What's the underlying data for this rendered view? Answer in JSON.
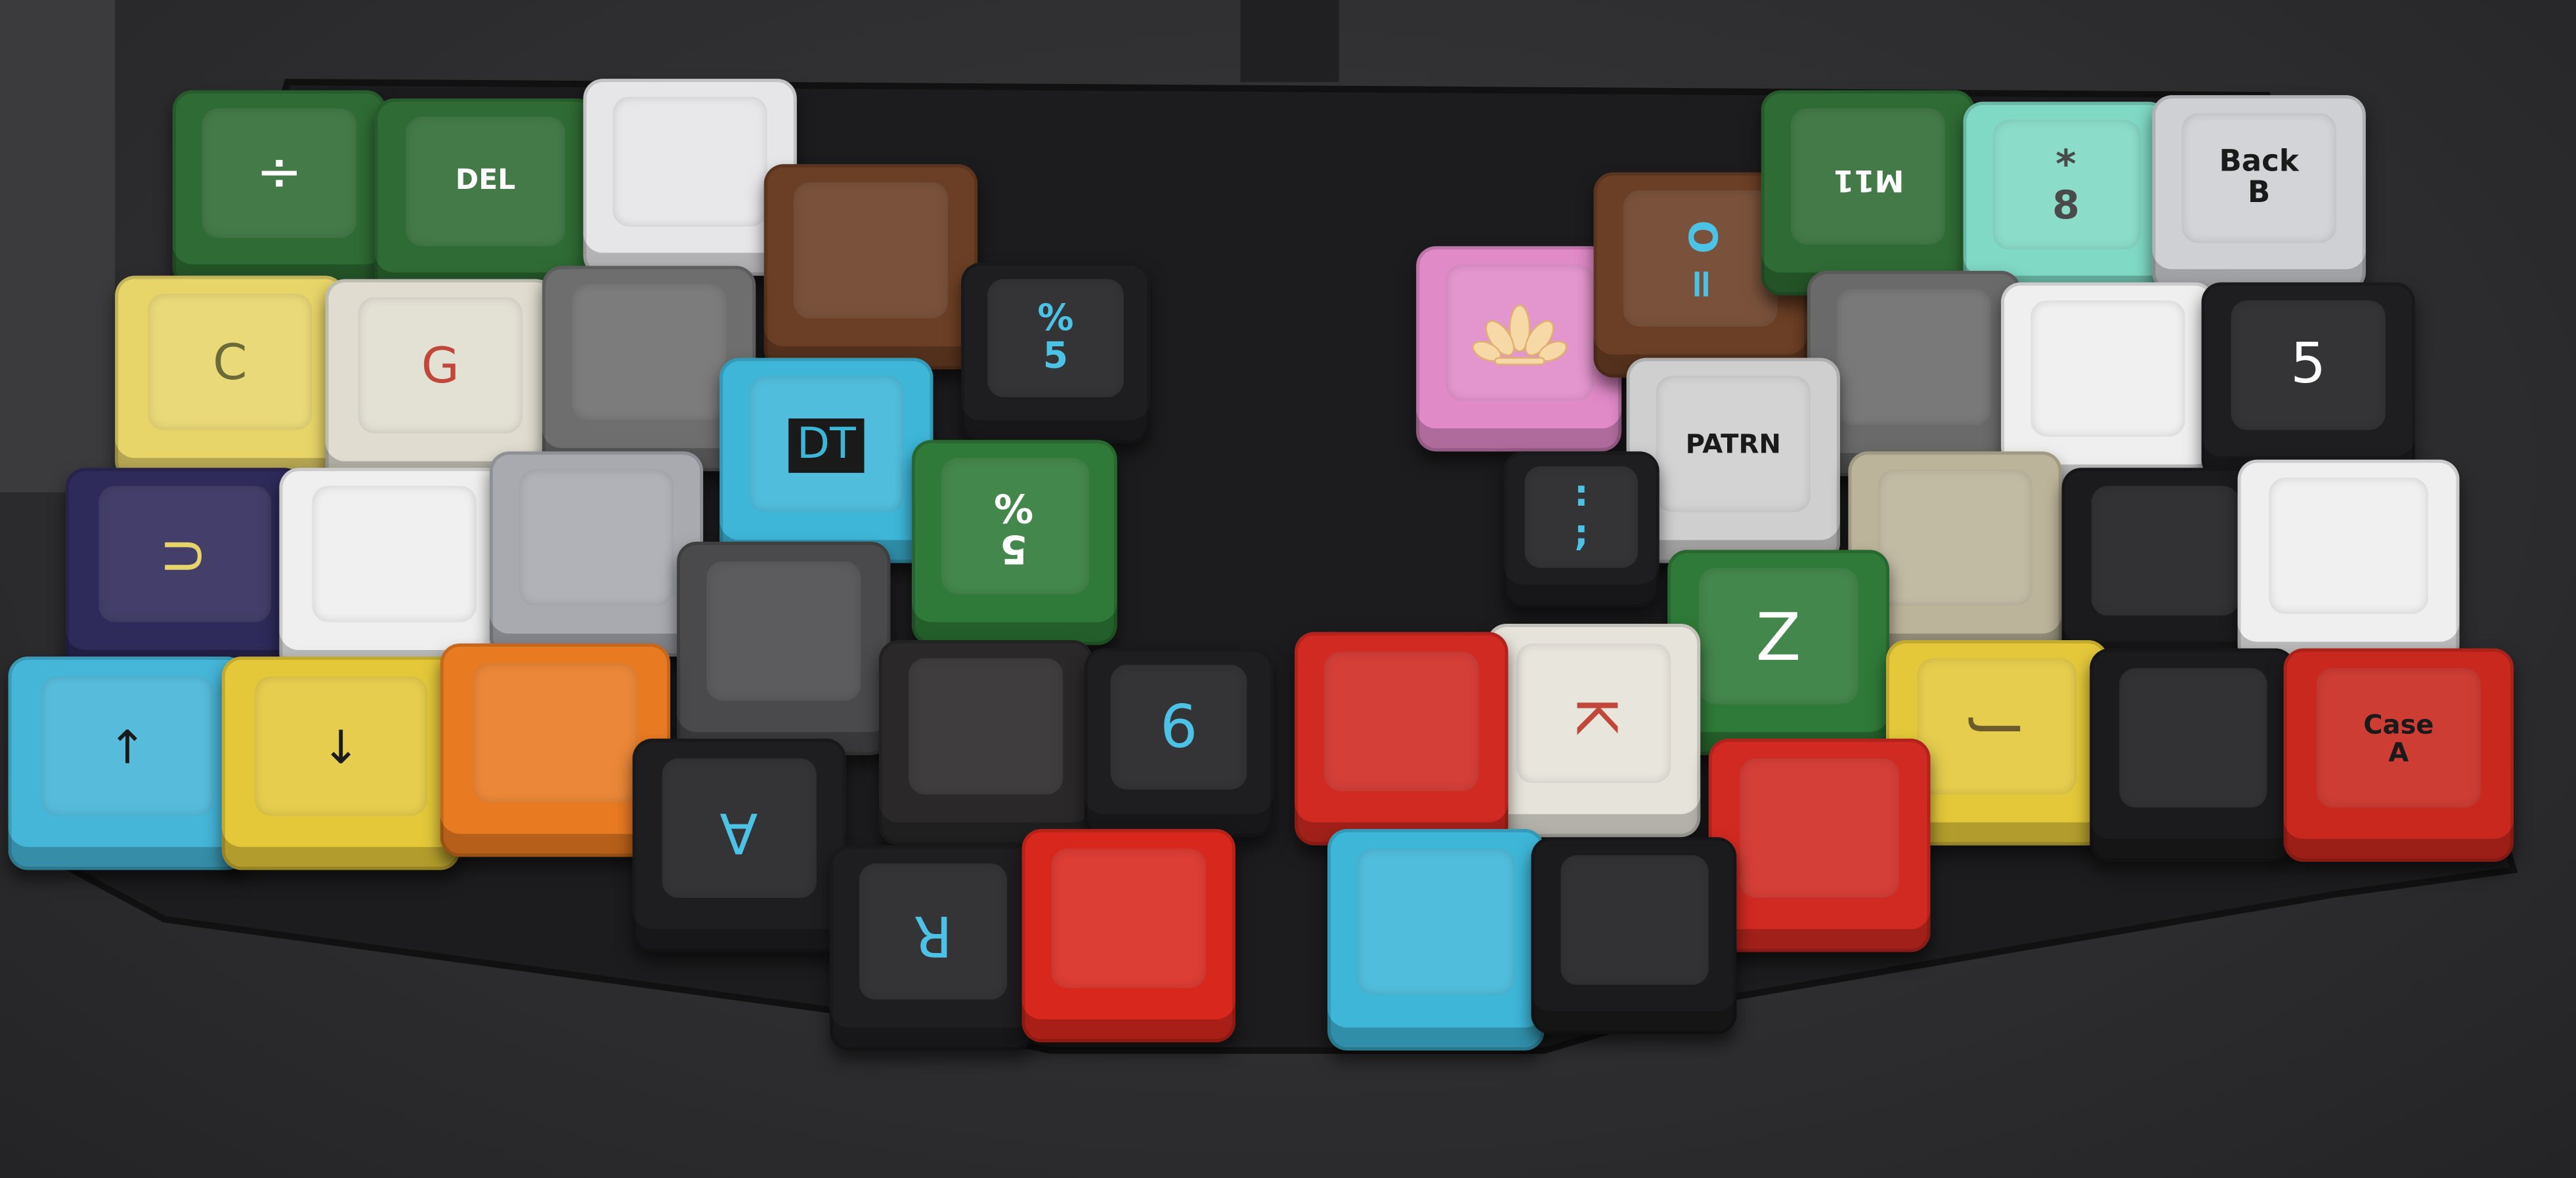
{
  "colors": {
    "background": "#2e2e30",
    "plate": "#1c1c1e",
    "green": "#2f6b34",
    "cyan_legend": "#4cc3e6"
  },
  "left_half": {
    "keys": [
      {
        "legend": "÷",
        "color": "#2f6b34",
        "legend_color": "#ffffff"
      },
      {
        "legend": "DEL",
        "color": "#2f6b34",
        "legend_color": "#ffffff"
      },
      {
        "legend": "",
        "color": "#e6e6e8"
      },
      {
        "legend": "",
        "color": "#6b3f25"
      },
      {
        "legend": "%\n5",
        "color": "#1e1e20",
        "legend_color": "#4cc3e6"
      },
      {
        "legend": "C",
        "color": "#e8d56a",
        "legend_color": "#6b6b3a"
      },
      {
        "legend": "G",
        "color": "#e0ddd0",
        "legend_color": "#c0473a"
      },
      {
        "legend": "",
        "color": "#6e6e6e"
      },
      {
        "legend": "DT",
        "color": "#3eb6d8",
        "legend_color": "#1a1a1a"
      },
      {
        "legend": "5\n%",
        "color": "#2f7a38",
        "legend_color": "#ffffff"
      },
      {
        "legend": "U",
        "color": "#2e2a5a",
        "legend_color": "#e8d56a"
      },
      {
        "legend": "",
        "color": "#efefef"
      },
      {
        "legend": "",
        "color": "#a8aab0"
      },
      {
        "legend": "",
        "color": "#4a4a4c"
      },
      {
        "legend": "↑",
        "color": "#45b5d8",
        "legend_color": "#1a1a1a"
      },
      {
        "legend": "↓",
        "color": "#e4c83a",
        "legend_color": "#1a1a1a"
      },
      {
        "legend": "",
        "color": "#e87a22"
      },
      {
        "legend": "",
        "color": "#2a2828"
      },
      {
        "legend": "6",
        "color": "#1e1e20",
        "legend_color": "#4cc3e6"
      },
      {
        "legend": "A",
        "color": "#1e1e20",
        "legend_color": "#4cc3e6"
      },
      {
        "legend": "R",
        "color": "#1e1e20",
        "legend_color": "#4cc3e6"
      },
      {
        "legend": "",
        "color": "#d8281e"
      }
    ]
  },
  "right_half": {
    "keys": [
      {
        "legend": "",
        "icon": "lotus-flower-icon",
        "color": "#e08ac8"
      },
      {
        "legend": "O =",
        "color": "#6b3f25",
        "legend_color": "#4cc3e6"
      },
      {
        "legend": "M11",
        "color": "#2f6b34",
        "legend_color": "#ffffff"
      },
      {
        "legend": "*\n8",
        "color": "#7fd9c4",
        "legend_color": "#4a4a4a"
      },
      {
        "legend": "Back\nB",
        "color": "#cfd0d4",
        "legend_color": "#1a1a1a"
      },
      {
        "legend": "",
        "color": "#6a6a6a"
      },
      {
        "legend": "",
        "color": "#efefef"
      },
      {
        "legend": "5",
        "color": "#1e1e20",
        "legend_color": "#ffffff"
      },
      {
        "legend": "PATRN",
        "color": "#cfcfcf",
        "legend_color": "#1a1a1a"
      },
      {
        "legend": ":\n;",
        "color": "#1e1e20",
        "legend_color": "#4cc3e6"
      },
      {
        "legend": "",
        "color": "#bcb49a"
      },
      {
        "legend": "",
        "color": "#1b1b1d"
      },
      {
        "legend": "",
        "color": "#efefef"
      },
      {
        "legend": "Z",
        "color": "#2f7a38",
        "legend_color": "#ffffff"
      },
      {
        "legend": "K",
        "color": "#e6e3da",
        "legend_color": "#c0473a"
      },
      {
        "legend": "",
        "color": "#d02a22"
      },
      {
        "legend": "J",
        "color": "#e4c83a",
        "legend_color": "#6b5a2a"
      },
      {
        "legend": "",
        "color": "#1b1b1d"
      },
      {
        "legend": "Case\nA",
        "color": "#c8281e",
        "legend_color": "#1a1a1a"
      },
      {
        "legend": "",
        "color": "#d02a22"
      },
      {
        "legend": "",
        "color": "#3eb6d8"
      },
      {
        "legend": "",
        "color": "#1b1b1d"
      }
    ]
  }
}
